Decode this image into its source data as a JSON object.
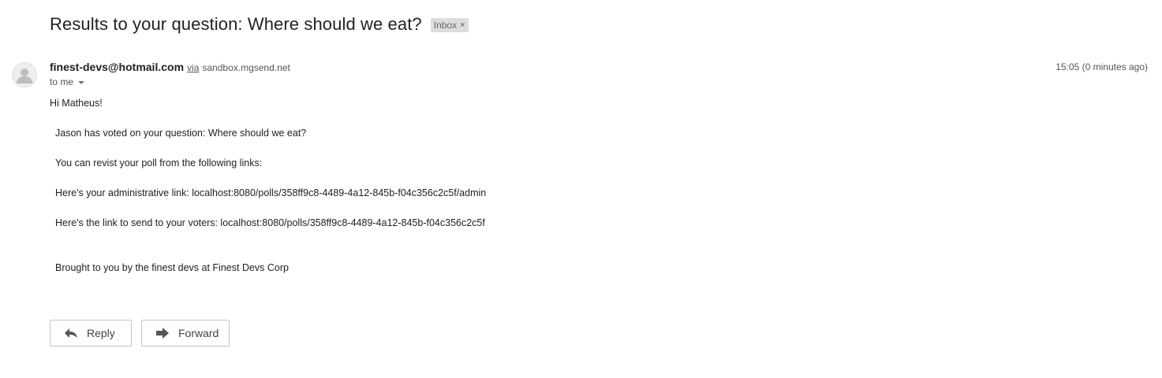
{
  "subject": "Results to your question: Where should we eat?",
  "label_chip": {
    "text": "Inbox",
    "close": "×"
  },
  "sender": {
    "name": "finest-devs@hotmail.com",
    "via_label": "via",
    "via_domain": "sandbox.mgsend.net"
  },
  "recipient": "to me",
  "timestamp": "15:05 (0 minutes ago)",
  "body": {
    "greeting": "Hi Matheus!",
    "vote_line": "Jason has voted on your question: Where should we eat?",
    "revisit_line": "You can revist your poll from the following links:",
    "admin_line": "Here's your administrative link: localhost:8080/polls/358ff9c8-4489-4a12-845b-f04c356c2c5f/admin",
    "voters_line": "Here's the link to send to your voters: localhost:8080/polls/358ff9c8-4489-4a12-845b-f04c356c2c5f",
    "signature": "Brought to you by the finest devs at Finest Devs Corp"
  },
  "actions": {
    "reply": "Reply",
    "forward": "Forward"
  },
  "icons": {
    "avatar": "default-avatar-icon",
    "reply": "reply-arrow-icon",
    "forward": "forward-arrow-icon",
    "caret": "chevron-down-icon"
  }
}
